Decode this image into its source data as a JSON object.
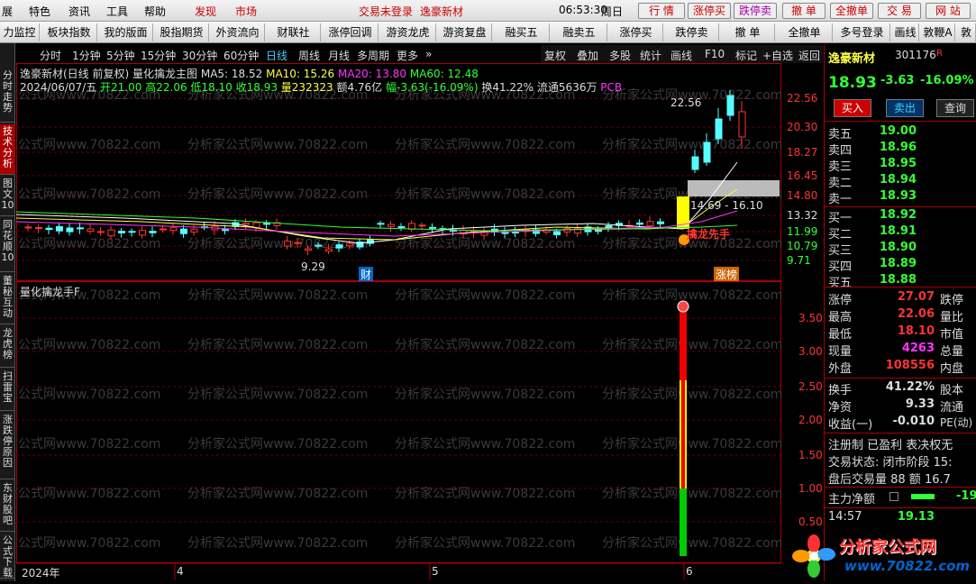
{
  "menu": {
    "items": [
      "展",
      "特色",
      "资讯",
      "工具",
      "帮助"
    ],
    "discover": "发现",
    "market": "市场",
    "login_status": "交易未登录",
    "stock_title": "逸豪新材",
    "clock": "06:53:30",
    "weekday": "周日",
    "right_buttons": [
      "行 情",
      "涨停买",
      "跌停卖",
      "撤 单",
      "全撤单",
      "交 易",
      "网 站"
    ]
  },
  "toolbar": [
    "力监控",
    "板块指数",
    "我的版面",
    "股指期货",
    "外资流向",
    "财联社",
    "涨停回调",
    "游资龙虎",
    "游资复盘",
    "融买五",
    "融卖五",
    "涨停买",
    "跌停卖",
    "撤 单",
    "全撤单",
    "多号登录",
    "画线",
    "敦鞭A",
    "敦鞭B"
  ],
  "sidebar": [
    "分时走势",
    "技术分析",
    "图文10",
    "同花顺10",
    "董秘互动",
    "龙虎榜",
    "扫雷宝",
    "涨跌停原因",
    "东财股吧",
    "公式下载"
  ],
  "periods": [
    "分时",
    "1分钟",
    "5分钟",
    "15分钟",
    "30分钟",
    "60分钟",
    "日线",
    "周线",
    "月线",
    "多周期",
    "更多"
  ],
  "active_period": "日线",
  "chart_options": [
    "复权",
    "叠加",
    "多股",
    "统计",
    "画线",
    "F10",
    "标记",
    "+自选",
    "返回"
  ],
  "main_legend": {
    "line1_name": "逸豪新材(日线 前复权)",
    "line1_formula": "量化擒龙主图",
    "ma5": "MA5: 18.52",
    "ma10": "MA10: 15.26",
    "ma20": "MA20: 13.80",
    "ma60": "MA60: 12.48",
    "date": "2024/06/07/五",
    "open": "开21.00",
    "high": "高22.06",
    "low": "低18.10",
    "close": "收18.93",
    "vol": "量232323",
    "amount": "额4.76亿",
    "change": "幅-3.63(-16.09%)",
    "turnover": "换41.22%",
    "float": "流通5636万",
    "tag": "PCB"
  },
  "main_axis": [
    "22.56",
    "20.30",
    "18.27",
    "16.45",
    "14.80",
    "13.32",
    "11.99",
    "10.79",
    "9.71"
  ],
  "annotations": {
    "high_label": "22.56",
    "low_label": "9.29",
    "range_label": "14.69 - 16.10",
    "dragon": "擒龙先手",
    "cai": "财",
    "zhangbang": "涨榜"
  },
  "sub_legend": "量化擒龙手F",
  "sub_axis": [
    "3.50",
    "3.00",
    "2.50",
    "2.00",
    "1.50",
    "1.00",
    "0.50"
  ],
  "date_axis": [
    "2024年",
    "4",
    "5",
    "6"
  ],
  "watermark": "分析家公式网www.70822.com",
  "quote": {
    "name": "逸豪新材",
    "code": "301176",
    "mark": "R",
    "price": "18.93",
    "change": "-3.63",
    "pct": "-16.09%",
    "buy_btn": "买入",
    "sell_btn": "卖出",
    "query_btn": "查询",
    "asks": [
      [
        "卖五",
        "19.00"
      ],
      [
        "卖四",
        "18.96"
      ],
      [
        "卖三",
        "18.95"
      ],
      [
        "卖二",
        "18.94"
      ],
      [
        "卖一",
        "18.93"
      ]
    ],
    "bids": [
      [
        "买一",
        "18.92"
      ],
      [
        "买二",
        "18.91"
      ],
      [
        "买三",
        "18.90"
      ],
      [
        "买四",
        "18.89"
      ],
      [
        "买五",
        "18.88"
      ]
    ],
    "limit_up_label": "涨停",
    "limit_up": "27.07",
    "limit_down_label": "跌停",
    "high_label": "最高",
    "high": "22.06",
    "vol_ratio_label": "量比",
    "low_label": "最低",
    "low": "18.10",
    "mcap_label": "市值",
    "cur_label": "现量",
    "cur": "4263",
    "total_label": "总量",
    "outer_label": "外盘",
    "outer": "108556",
    "inner_label": "内盘",
    "turnover_label": "换手",
    "turnover": "41.22%",
    "capital_label": "股本",
    "nav_label": "净资",
    "nav": "9.33",
    "flow_label": "流通",
    "eps_label": "收益(一)",
    "eps": "-0.010",
    "pe_label": "PE(动)",
    "reg": "注册制 已盈利 表决权无",
    "trade_status": "交易状态: 闭市阶段 15:",
    "after": "盘后交易量 88 额 16.7",
    "main_flow_label": "主力净额",
    "main_flow": "-19",
    "tick_time": "14:57",
    "tick_price": "19.13"
  },
  "logo": {
    "text": "分析家公式网",
    "url": "www.70822.com"
  }
}
